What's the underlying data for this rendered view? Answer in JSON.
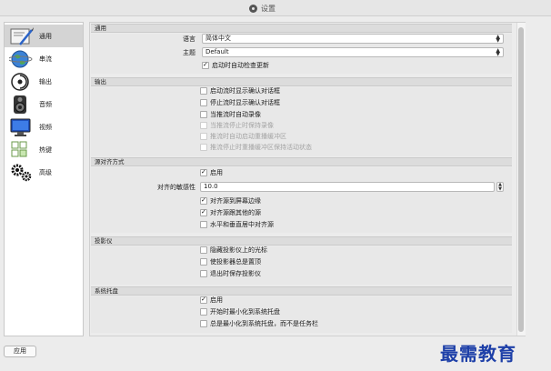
{
  "window": {
    "title": "设置"
  },
  "sidebar": {
    "items": [
      {
        "label": "通用",
        "icon": "general-icon",
        "selected": true
      },
      {
        "label": "串流",
        "icon": "globe-icon"
      },
      {
        "label": "输出",
        "icon": "output-icon"
      },
      {
        "label": "音频",
        "icon": "speaker-icon"
      },
      {
        "label": "视频",
        "icon": "monitor-icon"
      },
      {
        "label": "热键",
        "icon": "keyboard-icon"
      },
      {
        "label": "高级",
        "icon": "gears-icon"
      }
    ]
  },
  "sections": {
    "general": {
      "title": "通用",
      "language_label": "语言",
      "language_value": "简体中文",
      "theme_label": "主题",
      "theme_value": "Default",
      "auto_update": {
        "label": "启动时自动检查更新",
        "checked": true
      }
    },
    "output": {
      "title": "输出",
      "items": [
        {
          "label": "启动流时显示确认对话框",
          "checked": false
        },
        {
          "label": "停止流时显示确认对话框",
          "checked": false
        },
        {
          "label": "当推流时自动录像",
          "checked": false
        },
        {
          "label": "当推流停止时保持录像",
          "checked": false,
          "disabled": true
        },
        {
          "label": "推流时自动启动重播缓冲区",
          "checked": false,
          "disabled": true
        },
        {
          "label": "推流停止时重播缓冲区保持活动状态",
          "checked": false,
          "disabled": true
        }
      ]
    },
    "snapping": {
      "title": "源对齐方式",
      "enable": {
        "label": "启用",
        "checked": true
      },
      "sensitivity_label": "对齐的敏感性",
      "sensitivity_value": "10.0",
      "items": [
        {
          "label": "对齐源到屏幕边缘",
          "checked": true
        },
        {
          "label": "对齐源跟其他的源",
          "checked": true
        },
        {
          "label": "水平和垂直居中对齐源",
          "checked": false
        }
      ]
    },
    "projector": {
      "title": "投影仪",
      "items": [
        {
          "label": "隐藏投影仪上的光标",
          "checked": false
        },
        {
          "label": "使投影器总是置顶",
          "checked": false
        },
        {
          "label": "退出时保存投影仪",
          "checked": false
        }
      ]
    },
    "tray": {
      "title": "系统托盘",
      "items": [
        {
          "label": "启用",
          "checked": true
        },
        {
          "label": "开始时最小化到系统托盘",
          "checked": false
        },
        {
          "label": "总是最小化到系统托盘，而不是任务栏",
          "checked": false
        }
      ]
    }
  },
  "footer": {
    "apply_label": "应用"
  },
  "watermark": {
    "text": "最需教育"
  }
}
